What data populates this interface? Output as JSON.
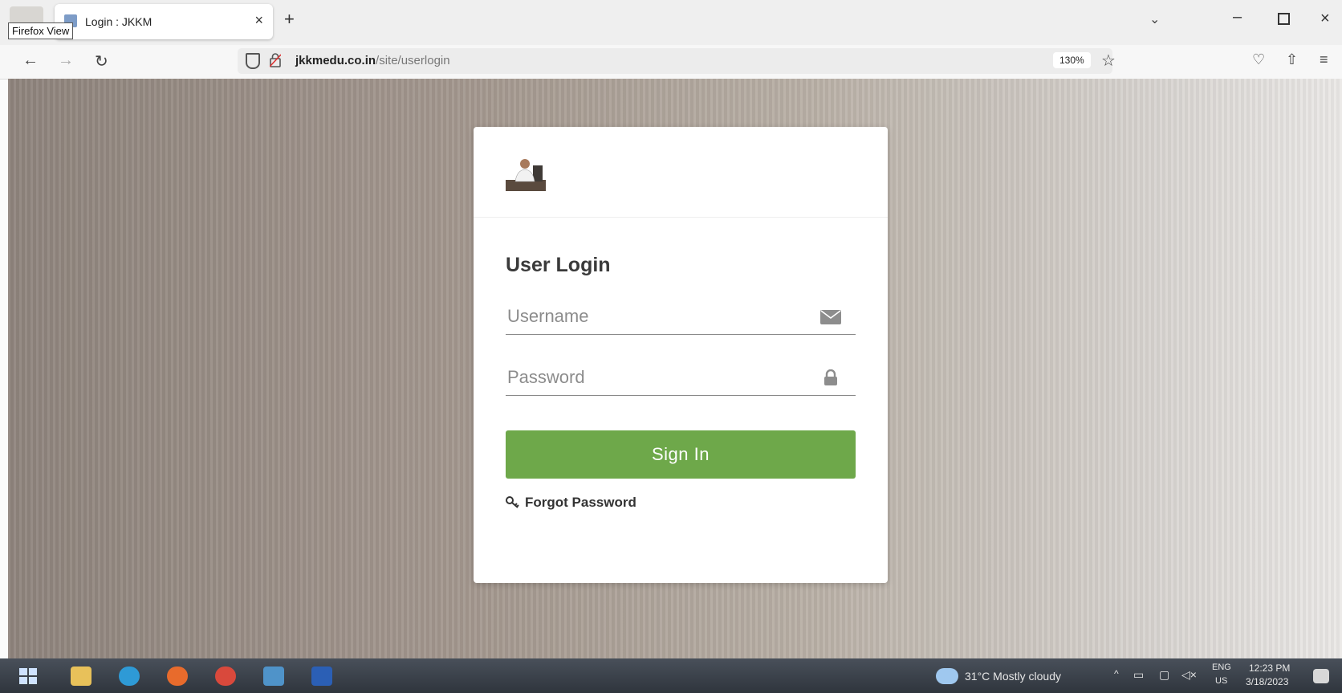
{
  "browser": {
    "tooltip": "Firefox View",
    "tab": {
      "title": "Login : JKKM",
      "close": "×"
    },
    "new_tab": "+",
    "tab_list": "⌄",
    "window": {
      "minimize": "–",
      "close": "×"
    },
    "nav": {
      "back": "←",
      "forward": "→",
      "reload": "↻"
    },
    "url": {
      "host": "jkkmedu.co.in",
      "path": "/site/userlogin"
    },
    "zoom": "130%",
    "bookmark": "☆",
    "tools": {
      "pocket": "♡",
      "extensions": "⇧",
      "menu": "≡"
    }
  },
  "login": {
    "title": "User Login",
    "username_placeholder": "Username",
    "password_placeholder": "Password",
    "signin_label": "Sign In",
    "forgot_label": "Forgot Password"
  },
  "taskbar": {
    "weather": "31°C  Mostly cloudy",
    "lang_top": "ENG",
    "lang_bottom": "US",
    "time": "12:23 PM",
    "date": "3/18/2023"
  },
  "colors": {
    "signin_green": "#6ea84a",
    "title_text": "#3a3a3a"
  }
}
